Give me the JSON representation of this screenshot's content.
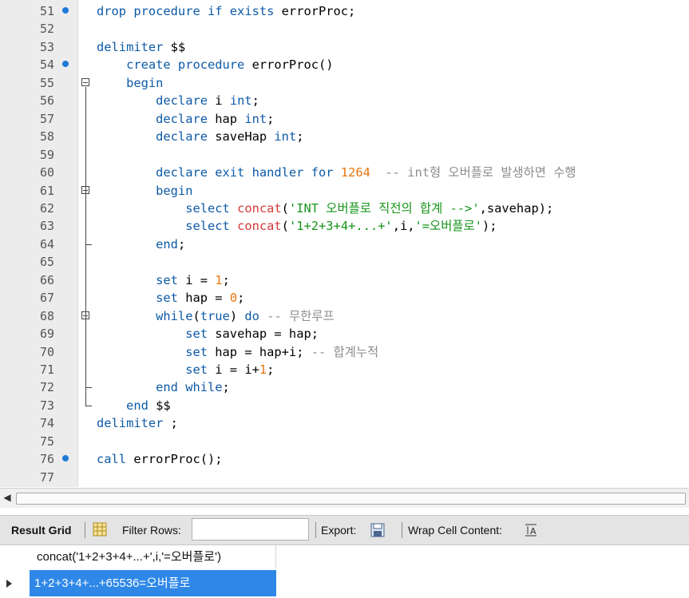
{
  "editor": {
    "lines": [
      {
        "num": "51",
        "dot": true,
        "segments": [
          {
            "t": "drop procedure if exists ",
            "c": "k"
          },
          {
            "t": "errorProc;",
            "c": ""
          }
        ]
      },
      {
        "num": "52",
        "segments": []
      },
      {
        "num": "53",
        "segments": [
          {
            "t": "delimiter ",
            "c": "k"
          },
          {
            "t": "$$",
            "c": ""
          }
        ]
      },
      {
        "num": "54",
        "dot": true,
        "segments": [
          {
            "t": "    create procedure ",
            "c": "k"
          },
          {
            "t": "errorProc()",
            "c": ""
          }
        ]
      },
      {
        "num": "55",
        "fold": "open",
        "segments": [
          {
            "t": "    begin",
            "c": "k"
          }
        ]
      },
      {
        "num": "56",
        "segments": [
          {
            "t": "        declare ",
            "c": "k"
          },
          {
            "t": "i ",
            "c": ""
          },
          {
            "t": "int",
            "c": "k"
          },
          {
            "t": ";",
            "c": ""
          }
        ]
      },
      {
        "num": "57",
        "segments": [
          {
            "t": "        declare ",
            "c": "k"
          },
          {
            "t": "hap ",
            "c": ""
          },
          {
            "t": "int",
            "c": "k"
          },
          {
            "t": ";",
            "c": ""
          }
        ]
      },
      {
        "num": "58",
        "segments": [
          {
            "t": "        declare ",
            "c": "k"
          },
          {
            "t": "saveHap ",
            "c": ""
          },
          {
            "t": "int",
            "c": "k"
          },
          {
            "t": ";",
            "c": ""
          }
        ]
      },
      {
        "num": "59",
        "segments": []
      },
      {
        "num": "60",
        "segments": [
          {
            "t": "        declare exit handler for ",
            "c": "k"
          },
          {
            "t": "1264",
            "c": "n"
          },
          {
            "t": "  -- int형 오버플로 발생하면 수행",
            "c": "c"
          }
        ]
      },
      {
        "num": "61",
        "fold": "open",
        "segments": [
          {
            "t": "        begin",
            "c": "k"
          }
        ]
      },
      {
        "num": "62",
        "segments": [
          {
            "t": "            select ",
            "c": "k"
          },
          {
            "t": "concat",
            "c": "f"
          },
          {
            "t": "(",
            "c": ""
          },
          {
            "t": "'INT 오버플로 직전의 합계 -->'",
            "c": "s"
          },
          {
            "t": ",savehap);",
            "c": ""
          }
        ]
      },
      {
        "num": "63",
        "segments": [
          {
            "t": "            select ",
            "c": "k"
          },
          {
            "t": "concat",
            "c": "f"
          },
          {
            "t": "(",
            "c": ""
          },
          {
            "t": "'1+2+3+4+...+'",
            "c": "s"
          },
          {
            "t": ",i,",
            "c": ""
          },
          {
            "t": "'=오버플로'",
            "c": "s"
          },
          {
            "t": ");",
            "c": ""
          }
        ]
      },
      {
        "num": "64",
        "fold": "end",
        "segments": [
          {
            "t": "        end",
            "c": "k"
          },
          {
            "t": ";",
            "c": ""
          }
        ]
      },
      {
        "num": "65",
        "segments": []
      },
      {
        "num": "66",
        "segments": [
          {
            "t": "        set ",
            "c": "k"
          },
          {
            "t": "i = ",
            "c": ""
          },
          {
            "t": "1",
            "c": "n"
          },
          {
            "t": ";",
            "c": ""
          }
        ]
      },
      {
        "num": "67",
        "segments": [
          {
            "t": "        set ",
            "c": "k"
          },
          {
            "t": "hap = ",
            "c": ""
          },
          {
            "t": "0",
            "c": "n"
          },
          {
            "t": ";",
            "c": ""
          }
        ]
      },
      {
        "num": "68",
        "fold": "open",
        "segments": [
          {
            "t": "        while",
            "c": "k"
          },
          {
            "t": "(",
            "c": ""
          },
          {
            "t": "true",
            "c": "k"
          },
          {
            "t": ") ",
            "c": ""
          },
          {
            "t": "do",
            "c": "k"
          },
          {
            "t": " -- 무한루프",
            "c": "c"
          }
        ]
      },
      {
        "num": "69",
        "segments": [
          {
            "t": "            set ",
            "c": "k"
          },
          {
            "t": "savehap = hap;",
            "c": ""
          }
        ]
      },
      {
        "num": "70",
        "segments": [
          {
            "t": "            set ",
            "c": "k"
          },
          {
            "t": "hap = hap+i; ",
            "c": ""
          },
          {
            "t": "-- 합계누적",
            "c": "c"
          }
        ]
      },
      {
        "num": "71",
        "segments": [
          {
            "t": "            set ",
            "c": "k"
          },
          {
            "t": "i = i+",
            "c": ""
          },
          {
            "t": "1",
            "c": "n"
          },
          {
            "t": ";",
            "c": ""
          }
        ]
      },
      {
        "num": "72",
        "fold": "end",
        "segments": [
          {
            "t": "        end while",
            "c": "k"
          },
          {
            "t": ";",
            "c": ""
          }
        ]
      },
      {
        "num": "73",
        "fold": "end",
        "segments": [
          {
            "t": "    end ",
            "c": "k"
          },
          {
            "t": "$$",
            "c": ""
          }
        ]
      },
      {
        "num": "74",
        "segments": [
          {
            "t": "delimiter ",
            "c": "k"
          },
          {
            "t": ";",
            "c": ""
          }
        ]
      },
      {
        "num": "75",
        "segments": []
      },
      {
        "num": "76",
        "dot": true,
        "segments": [
          {
            "t": "call ",
            "c": "k"
          },
          {
            "t": "errorProc();",
            "c": ""
          }
        ]
      },
      {
        "num": "77",
        "segments": []
      }
    ]
  },
  "toolbar": {
    "result_grid_label": "Result Grid",
    "filter_rows_label": "Filter Rows:",
    "filter_rows_value": "",
    "export_label": "Export:",
    "wrap_cell_label": "Wrap Cell Content:"
  },
  "results": {
    "column_header": "concat('1+2+3+4+...+',i,'=오버플로')",
    "rows": [
      "1+2+3+4+...+65536=오버플로"
    ]
  },
  "colors": {
    "keyword": "#0d5aa7",
    "number": "#e7760f",
    "string": "#16951a",
    "comment": "#8c8c8c",
    "function": "#d23a3a",
    "selection": "#2f88e8"
  }
}
